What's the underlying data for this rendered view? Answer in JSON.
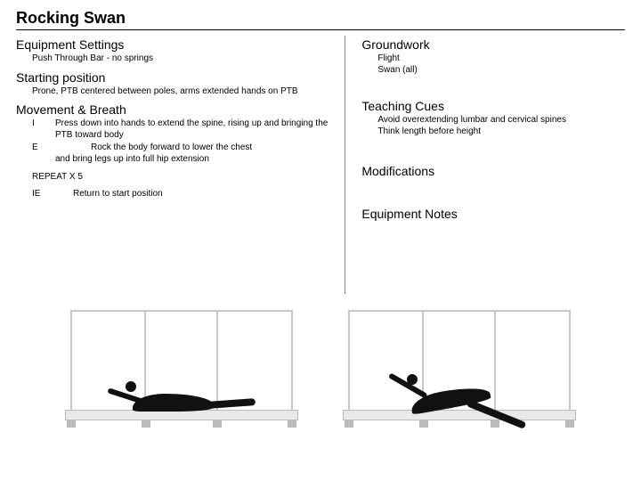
{
  "title": "Rocking Swan",
  "left": {
    "equipment_h": "Equipment Settings",
    "equipment_body": "Push Through Bar - no springs",
    "start_h": "Starting position",
    "start_body": "Prone, PTB centered between poles, arms extended hands on PTB",
    "move_h": "Movement & Breath",
    "rows": [
      {
        "key": "I",
        "text": "Press down into hands to extend the spine, rising up and bringing the PTB toward body"
      },
      {
        "key": "E",
        "text_line1": "Rock the body forward to lower the chest",
        "text_line2": "and bring legs up into full hip extension"
      }
    ],
    "repeat": "REPEAT X 5",
    "return_row": {
      "key": "IE",
      "text": "Return to start position"
    }
  },
  "right": {
    "ground_h": "Groundwork",
    "ground_lines": [
      "Flight",
      "Swan (all)"
    ],
    "cues_h": "Teaching Cues",
    "cues_lines": [
      "Avoid overextending lumbar and cervical spines",
      "Think length before height"
    ],
    "mods_h": "Modifications",
    "notes_h": "Equipment Notes"
  },
  "figures": [
    {
      "name": "pose-start",
      "alt": "Prone on trapeze table, arms forward on push-through bar"
    },
    {
      "name": "pose-extended",
      "alt": "Rocking swan extension, chest lifted legs raised"
    }
  ]
}
